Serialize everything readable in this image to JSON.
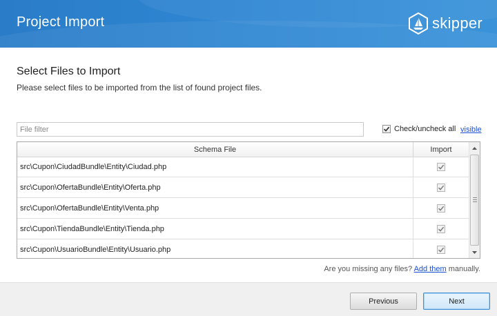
{
  "header": {
    "title": "Project Import",
    "brand_name": "skipper",
    "brand_logo_icon": "sailboat-icon",
    "colors": {
      "background": "#2f86d2",
      "text": "#ffffff"
    }
  },
  "section": {
    "title": "Select Files to Import",
    "description": "Please select files to be imported from the list of found project files."
  },
  "filter": {
    "placeholder": "File filter",
    "value": ""
  },
  "check_all": {
    "label": "Check/uncheck all",
    "checked": true
  },
  "visible_link": "visible",
  "table": {
    "columns": [
      "Schema File",
      "Import"
    ],
    "rows": [
      {
        "file": "src\\Cupon\\CiudadBundle\\Entity\\Ciudad.php",
        "import": true
      },
      {
        "file": "src\\Cupon\\OfertaBundle\\Entity\\Oferta.php",
        "import": true
      },
      {
        "file": "src\\Cupon\\OfertaBundle\\Entity\\Venta.php",
        "import": true
      },
      {
        "file": "src\\Cupon\\TiendaBundle\\Entity\\Tienda.php",
        "import": true
      },
      {
        "file": "src\\Cupon\\UsuarioBundle\\Entity\\Usuario.php",
        "import": true
      }
    ]
  },
  "missing": {
    "prefix": "Are you missing any files? ",
    "link": "Add them",
    "suffix": " manually."
  },
  "buttons": {
    "previous": "Previous",
    "next": "Next"
  },
  "accent_color": "#1a4fd6"
}
